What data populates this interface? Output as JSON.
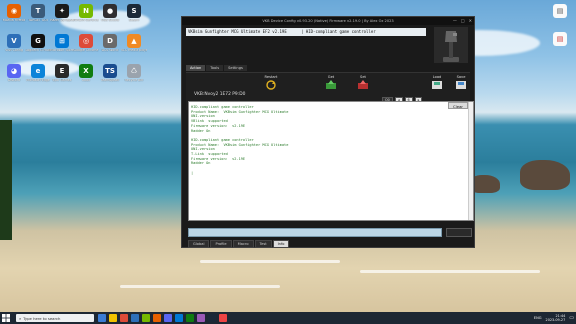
{
  "window": {
    "title": "VKB Device Config v0.93.20 (Native) Firmware v2.19.0 | By Alex Oz 2023",
    "controls": [
      "—",
      "□",
      "✕"
    ],
    "device_name": "VKBsim Gunfighter MCG Ultimate EF2 v2.19E",
    "device_desc": "| HID-compliant game controller",
    "tabs": [
      "Action",
      "Tools",
      "Settings"
    ],
    "vid_pid": "VKB:Nvoy2 1E72 P9:D0",
    "pdev": "PID 0124",
    "buttons": {
      "restart": "Restart",
      "get": "Get",
      "set": "Set",
      "load": "Load",
      "save": "Save"
    },
    "zoom_label": "Q0",
    "zoom_value": "6",
    "clear_label": "Clear",
    "log": "HID-compliant game controller\nProduct Name:  VKBsim Gunfighter MCG Ultimate\nUNI-version\nVBlink  supported\nFirmware version:  v2.19E\nRadder On\n\nHID-compliant game controller\nProduct Name:  VKBsim Gunfighter MCG Ultimate\nUNI-version\nT-Link  supported\nFirmware version:  v2.19E\nRadder On\n\n|",
    "bottom_tabs": [
      "Global",
      "Profile",
      "Macro",
      "Test",
      "Info"
    ],
    "active_bottom_tab": "Info"
  },
  "desktop_icons": [
    {
      "label": "Mozilla Firefox",
      "color": "#e66000",
      "glyph": "◉"
    },
    {
      "label": "TARGET GUI",
      "color": "#3a5b7a",
      "glyph": "T"
    },
    {
      "label": "Razer Synapse",
      "color": "#1a1a1a",
      "glyph": "✦"
    },
    {
      "label": "NVIDIA GeForce",
      "color": "#76b900",
      "glyph": "N"
    },
    {
      "label": "OBS Studio",
      "color": "#302e31",
      "glyph": "●"
    },
    {
      "label": "Steam",
      "color": "#1b2838",
      "glyph": "S"
    },
    {
      "label": "VKB Config",
      "color": "#2d6fb8",
      "glyph": "V"
    },
    {
      "label": "Logitech G HUB",
      "color": "#101010",
      "glyph": "G"
    },
    {
      "label": "Microsoft Store",
      "color": "#0078d4",
      "glyph": "⊞"
    },
    {
      "label": "Google Chrome",
      "color": "#dd4b39",
      "glyph": "◎"
    },
    {
      "label": "DCS World",
      "color": "#6a6a6a",
      "glyph": "D"
    },
    {
      "label": "VLC media player",
      "color": "#f08a24",
      "glyph": "▲"
    },
    {
      "label": "Discord",
      "color": "#5865f2",
      "glyph": "◕"
    },
    {
      "label": "Microsoft Edge",
      "color": "#0c84d9",
      "glyph": "e"
    },
    {
      "label": "Epic Games",
      "color": "#2a2a2a",
      "glyph": "E"
    },
    {
      "label": "Xbox",
      "color": "#107c10",
      "glyph": "X"
    },
    {
      "label": "TeamSpeak",
      "color": "#1a4d8f",
      "glyph": "TS"
    },
    {
      "label": "Recycle Bin",
      "color": "#9aa3ad",
      "glyph": "♺"
    }
  ],
  "taskbar": {
    "search_placeholder": "Type here to search",
    "time": "21:44",
    "date": "2023-09-27",
    "lang": "ENG",
    "app_colors": [
      "#3a7bd5",
      "#f2c200",
      "#dd4b39",
      "#2d6fb8",
      "#76b900",
      "#e66000",
      "#5865f2",
      "#0078d4",
      "#107c10",
      "#9b59b6",
      "#1b2838",
      "#e44"
    ]
  }
}
